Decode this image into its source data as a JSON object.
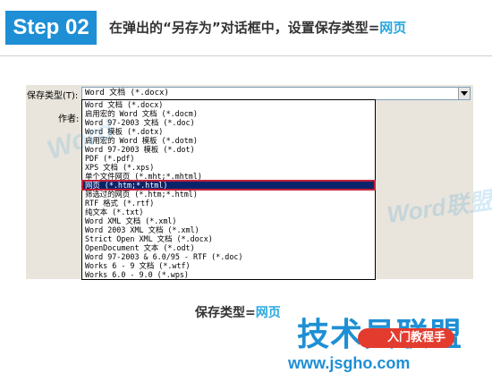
{
  "header": {
    "step_label": "Step 02",
    "instruction_text": "在弹出的“另存为”对话框中，设置保存类型=",
    "instruction_highlight": "网页"
  },
  "dialog": {
    "save_type_label": "保存类型(T):",
    "author_label": "作者:",
    "save_type_value": "Word 文档 (*.docx)",
    "options": [
      "Word 文档 (*.docx)",
      "启用宏的 Word 文档 (*.docm)",
      "Word 97-2003 文档 (*.doc)",
      "Word 模板 (*.dotx)",
      "启用宏的 Word 模板 (*.dotm)",
      "Word 97-2003 模板 (*.dot)",
      "PDF (*.pdf)",
      "XPS 文档 (*.xps)",
      "单个文件网页 (*.mht;*.mhtml)",
      "网页 (*.htm;*.html)",
      "筛选过的网页 (*.htm;*.html)",
      "RTF 格式 (*.rtf)",
      "纯文本 (*.txt)",
      "Word XML 文档 (*.xml)",
      "Word 2003 XML 文档 (*.xml)",
      "Strict Open XML 文档 (*.docx)",
      "OpenDocument 文本 (*.odt)",
      "Word 97-2003 & 6.0/95 - RTF (*.doc)",
      "Works 6 - 9 文档 (*.wtf)",
      "Works 6.0 - 9.0 (*.wps)"
    ],
    "selected_index": 9
  },
  "caption": {
    "text": "保存类型=",
    "highlight": "网页"
  },
  "watermark": {
    "text1": "Word",
    "text2": "Word联盟"
  },
  "brand": {
    "title": "技术员联盟",
    "pill": "入门教程手",
    "site": "www.jsgho.com"
  },
  "colors": {
    "accent": "#1e8fd4",
    "highlight": "#2aa8df",
    "selection_bg": "#0a246a",
    "selection_border": "#c3213a",
    "pill": "#e33b2e"
  }
}
